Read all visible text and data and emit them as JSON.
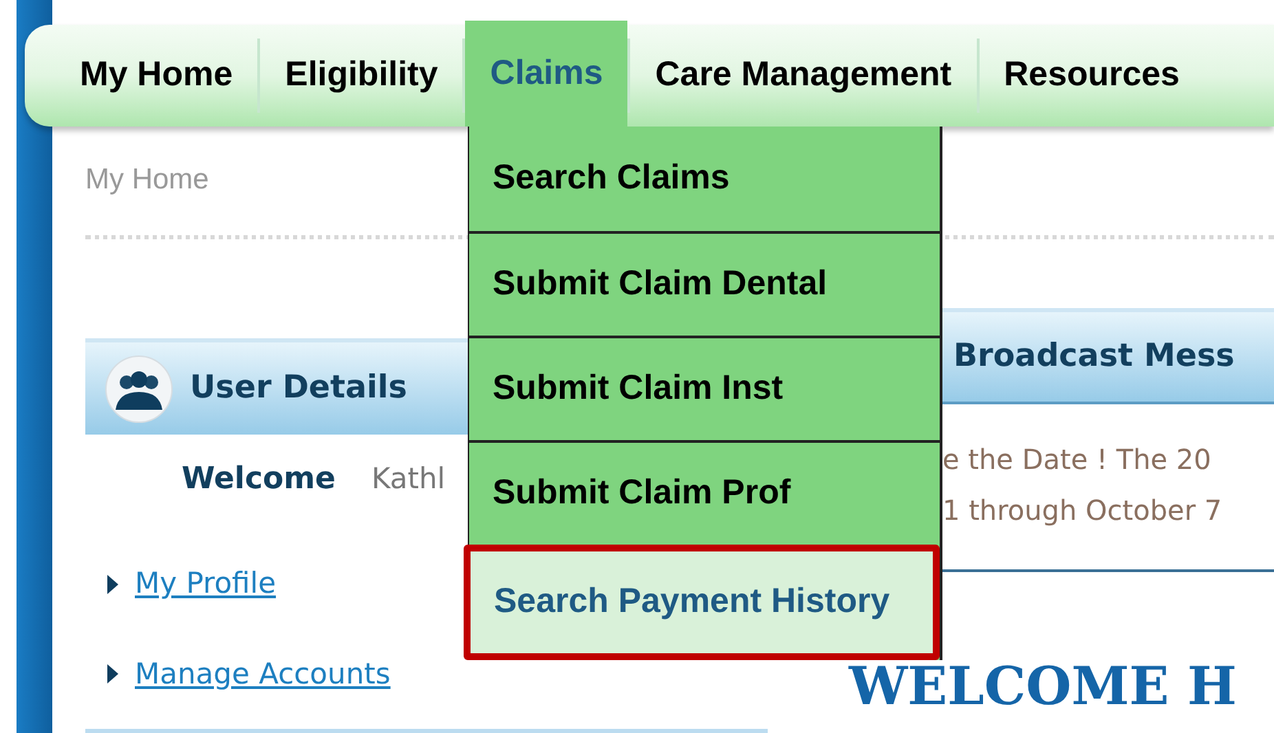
{
  "nav": {
    "tabs": [
      {
        "label": "My Home",
        "selected": false
      },
      {
        "label": "Eligibility",
        "selected": false
      },
      {
        "label": "Claims",
        "selected": true
      },
      {
        "label": "Care Management",
        "selected": false
      },
      {
        "label": "Resources",
        "selected": false
      }
    ]
  },
  "claims_menu": {
    "items": [
      {
        "label": "Search Claims",
        "selected": false,
        "outlined": false
      },
      {
        "label": "Submit Claim Dental",
        "selected": false,
        "outlined": false
      },
      {
        "label": "Submit Claim Inst",
        "selected": false,
        "outlined": false
      },
      {
        "label": "Submit Claim Prof",
        "selected": false,
        "outlined": false
      },
      {
        "label": "Search Payment History",
        "selected": true,
        "outlined": true
      }
    ]
  },
  "breadcrumb": "My Home",
  "user_details": {
    "title": "User Details",
    "welcome_label": "Welcome",
    "user_name": "Kathl",
    "links": [
      "My Profile",
      "Manage Accounts"
    ]
  },
  "broadcast": {
    "title": "Broadcast Mess",
    "lines": [
      "e the Date ! The 20",
      "1 through October 7"
    ]
  },
  "welcome_banner": "WELCOME H"
}
